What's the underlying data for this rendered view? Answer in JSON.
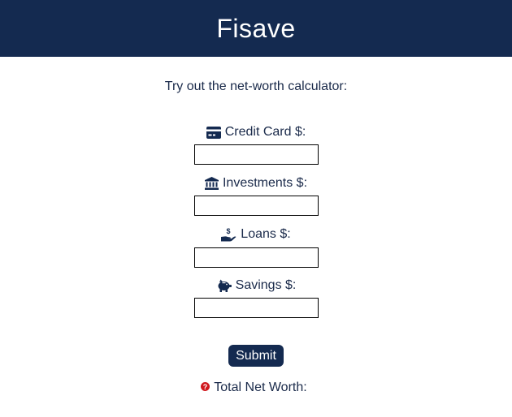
{
  "header": {
    "title": "Fisave"
  },
  "intro": {
    "text": "Try out the net-worth calculator:"
  },
  "fields": [
    {
      "label": "Credit Card $:",
      "icon": "credit-card-icon",
      "value": ""
    },
    {
      "label": "Investments $:",
      "icon": "bank-icon",
      "value": ""
    },
    {
      "label": "Loans $:",
      "icon": "hand-holding-dollar-icon",
      "value": ""
    },
    {
      "label": "Savings $:",
      "icon": "piggy-bank-icon",
      "value": ""
    }
  ],
  "submit": {
    "label": "Submit"
  },
  "total": {
    "label": "Total Net Worth:",
    "icon": "question-circle-icon",
    "value": ""
  },
  "colors": {
    "brand": "#142a50",
    "text": "#1a2a4a",
    "help_icon": "#d0191e"
  }
}
